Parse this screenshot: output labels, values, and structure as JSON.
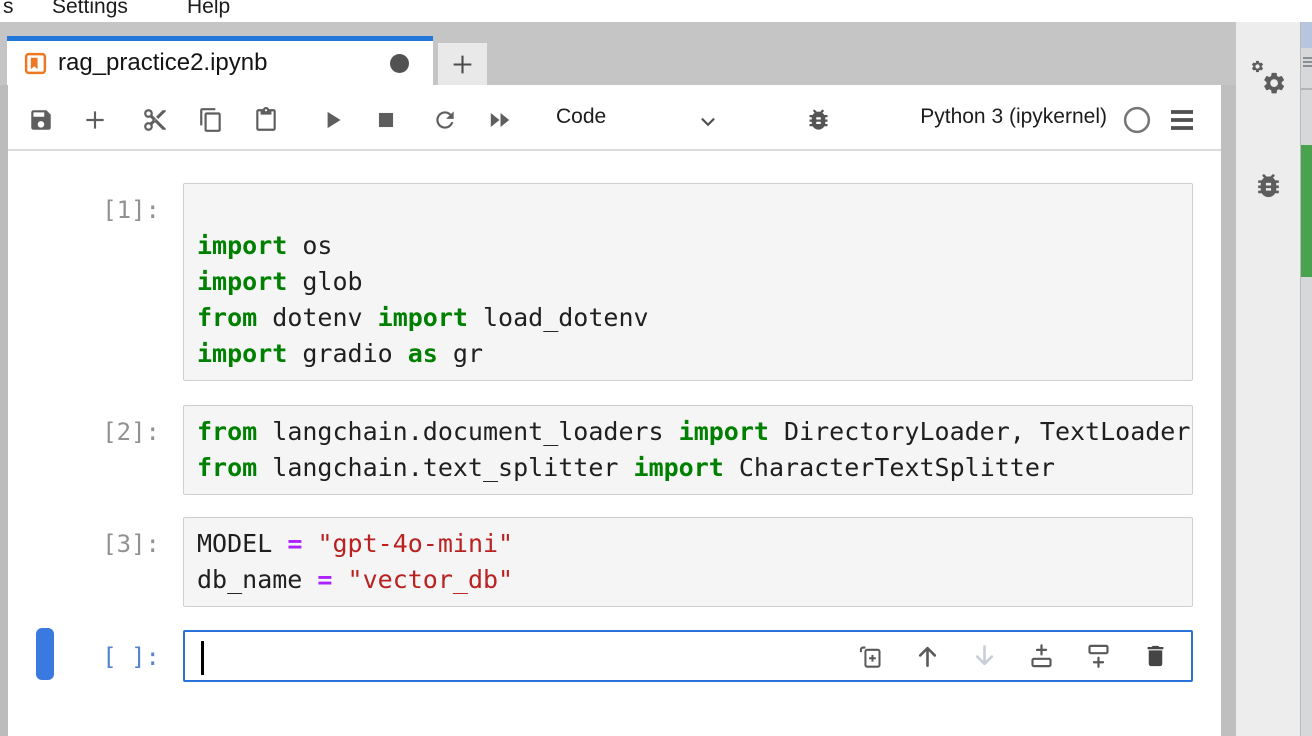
{
  "menu": {
    "items": [
      {
        "label": "s"
      },
      {
        "label": "Settings"
      },
      {
        "label": "Help"
      }
    ]
  },
  "tabbar": {
    "active_tab": {
      "title": "rag_practice2.ipynb",
      "modified": true
    },
    "new_tab_label": "+"
  },
  "toolbar": {
    "icons": [
      "save-icon",
      "add-cell-icon",
      "cut-cells-icon",
      "copy-cells-icon",
      "paste-cells-icon",
      "run-cell-icon",
      "interrupt-kernel-icon",
      "restart-kernel-icon",
      "run-all-cells-icon"
    ],
    "cell_type_value": "Code",
    "kernel_name": "Python 3 (ipykernel)",
    "kernel_status": "idle"
  },
  "right_sidebar": {
    "icons": [
      "property-inspector-gears-icon",
      "debugger-bug-icon"
    ]
  },
  "notebook": {
    "cells": [
      {
        "prompt": "[1]:",
        "active": false,
        "lines": [
          [],
          [
            {
              "t": "kw",
              "v": "import"
            },
            {
              "t": "pl",
              "v": " os"
            }
          ],
          [
            {
              "t": "kw",
              "v": "import"
            },
            {
              "t": "pl",
              "v": " glob"
            }
          ],
          [
            {
              "t": "kw",
              "v": "from"
            },
            {
              "t": "pl",
              "v": " dotenv "
            },
            {
              "t": "kw",
              "v": "import"
            },
            {
              "t": "pl",
              "v": " load_dotenv"
            }
          ],
          [
            {
              "t": "kw",
              "v": "import"
            },
            {
              "t": "pl",
              "v": " gradio "
            },
            {
              "t": "kw",
              "v": "as"
            },
            {
              "t": "pl",
              "v": " gr"
            }
          ]
        ]
      },
      {
        "prompt": "[2]:",
        "active": false,
        "lines": [
          [
            {
              "t": "kw",
              "v": "from"
            },
            {
              "t": "pl",
              "v": " langchain.document_loaders "
            },
            {
              "t": "kw",
              "v": "import"
            },
            {
              "t": "pl",
              "v": " DirectoryLoader, TextLoader"
            }
          ],
          [
            {
              "t": "kw",
              "v": "from"
            },
            {
              "t": "pl",
              "v": " langchain.text_splitter "
            },
            {
              "t": "kw",
              "v": "import"
            },
            {
              "t": "pl",
              "v": " CharacterTextSplitter"
            }
          ]
        ]
      },
      {
        "prompt": "[3]:",
        "active": false,
        "lines": [
          [
            {
              "t": "pl",
              "v": "MODEL "
            },
            {
              "t": "op",
              "v": "="
            },
            {
              "t": "pl",
              "v": " "
            },
            {
              "t": "str",
              "v": "\"gpt-4o-mini\""
            }
          ],
          [
            {
              "t": "pl",
              "v": "db_name "
            },
            {
              "t": "op",
              "v": "="
            },
            {
              "t": "pl",
              "v": " "
            },
            {
              "t": "str",
              "v": "\"vector_db\""
            }
          ]
        ]
      },
      {
        "prompt": "[ ]:",
        "active": true,
        "cursor": true,
        "lines": [
          []
        ],
        "toolbar": [
          {
            "name": "duplicate-cell-icon"
          },
          {
            "name": "move-cell-up-icon"
          },
          {
            "name": "move-cell-down-icon",
            "disabled": true
          },
          {
            "name": "insert-cell-above-icon"
          },
          {
            "name": "insert-cell-below-icon"
          },
          {
            "name": "delete-cell-icon",
            "strong": true
          }
        ]
      }
    ]
  },
  "colors": {
    "accent_blue": "#2176d9",
    "active_cell_border": "#2b72d8",
    "jupyter_orange": "#ee7722",
    "keyword_green": "#008000",
    "string_red": "#BA2121",
    "operator_purple": "#AA22FF",
    "status_green_strip": "#49a24d"
  }
}
